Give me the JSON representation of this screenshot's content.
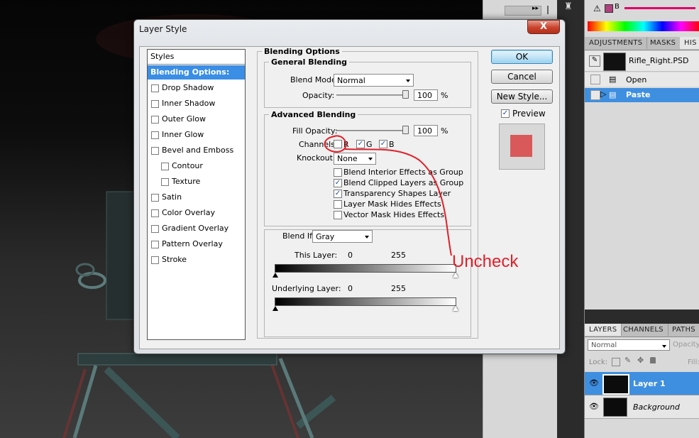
{
  "dialog": {
    "title": "Layer Style",
    "close": "X",
    "styles_header": "Styles",
    "styles": [
      {
        "label": "Blending Options: Custom",
        "selected": true,
        "checkbox": false,
        "indent": 0
      },
      {
        "label": "Drop Shadow",
        "checkbox": true,
        "indent": 0
      },
      {
        "label": "Inner Shadow",
        "checkbox": true,
        "indent": 0
      },
      {
        "label": "Outer Glow",
        "checkbox": true,
        "indent": 0
      },
      {
        "label": "Inner Glow",
        "checkbox": true,
        "indent": 0
      },
      {
        "label": "Bevel and Emboss",
        "checkbox": true,
        "indent": 0
      },
      {
        "label": "Contour",
        "checkbox": true,
        "indent": 1
      },
      {
        "label": "Texture",
        "checkbox": true,
        "indent": 1
      },
      {
        "label": "Satin",
        "checkbox": true,
        "indent": 0
      },
      {
        "label": "Color Overlay",
        "checkbox": true,
        "indent": 0
      },
      {
        "label": "Gradient Overlay",
        "checkbox": true,
        "indent": 0
      },
      {
        "label": "Pattern Overlay",
        "checkbox": true,
        "indent": 0
      },
      {
        "label": "Stroke",
        "checkbox": true,
        "indent": 0
      }
    ],
    "blending": {
      "title": "Blending Options",
      "general_title": "General Blending",
      "blend_mode_label": "Blend Mode:",
      "blend_mode": "Normal",
      "opacity_label": "Opacity:",
      "opacity": "100",
      "opacity_unit": "%",
      "advanced_title": "Advanced Blending",
      "fill_label": "Fill Opacity:",
      "fill": "100",
      "fill_unit": "%",
      "channels_label": "Channels:",
      "channels": [
        {
          "label": "R",
          "checked": false
        },
        {
          "label": "G",
          "checked": true
        },
        {
          "label": "B",
          "checked": true
        }
      ],
      "knockout_label": "Knockout:",
      "knockout": "None",
      "options": [
        {
          "label": "Blend Interior Effects as Group",
          "checked": false
        },
        {
          "label": "Blend Clipped Layers as Group",
          "checked": true
        },
        {
          "label": "Transparency Shapes Layer",
          "checked": true
        },
        {
          "label": "Layer Mask Hides Effects",
          "checked": false
        },
        {
          "label": "Vector Mask Hides Effects",
          "checked": false
        }
      ],
      "blend_if_label": "Blend If:",
      "blend_if": "Gray",
      "this_layer_label": "This Layer:",
      "this_low": "0",
      "this_high": "255",
      "underlying_label": "Underlying Layer:",
      "under_low": "0",
      "under_high": "255"
    },
    "buttons": {
      "ok": "OK",
      "cancel": "Cancel",
      "new_style": "New Style...",
      "preview": "Preview",
      "preview_checked": true
    },
    "preview_color": "#d9595a"
  },
  "annotation": {
    "text": "Uncheck",
    "color": "#e0202a"
  },
  "panels": {
    "info": {
      "label_b": "B",
      "warning": "⚠"
    },
    "top_tabs": [
      "ADJUSTMENTS",
      "MASKS",
      "HIS"
    ],
    "history": {
      "snapshot": "Rifle_Right.PSD",
      "items": [
        {
          "label": "Open",
          "selected": false
        },
        {
          "label": "Paste",
          "selected": true
        }
      ]
    },
    "layer_tabs": [
      "LAYERS",
      "CHANNELS",
      "PATHS"
    ],
    "blend_mode": "Normal",
    "opacity_label": "Opacity:",
    "lock_label": "Lock:",
    "fill_label": "Fill:",
    "layers": [
      {
        "name": "Layer 1",
        "selected": true
      },
      {
        "name": "Background",
        "selected": false
      }
    ]
  }
}
